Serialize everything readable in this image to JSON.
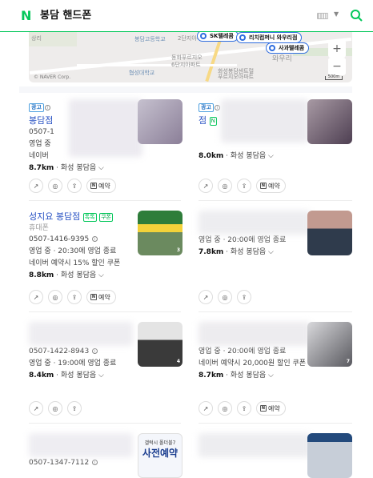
{
  "header": {
    "logo": "N",
    "query": "봉담 핸드폰"
  },
  "map": {
    "labels": {
      "a": "상리",
      "b": "봉담고등학교",
      "c": "2단지아파트",
      "d": "봉담대학교",
      "e": "동화푸르지오",
      "f": "6단지아파트",
      "g": "와우리",
      "h": "화성봉담센트럴",
      "i": "수영봉담풍림",
      "j": "아파트1단지",
      "k": "푸르지오아파트",
      "l": "협성대학교"
    },
    "pins": [
      "SK텔레콤",
      "리치컴퍼니 와우리점",
      "사과텔레콤"
    ],
    "attribution": "© NAVER Corp.",
    "scale": "500m",
    "zoom_in": "+",
    "zoom_out": "−"
  },
  "cards": [
    {
      "ad_label": "광고",
      "name": "봉담점",
      "phone": "0507-1",
      "status": "영업 중",
      "coupon": "네이버",
      "distance": "8.7km",
      "area": "화성 봉담읍",
      "has_reserve": true
    },
    {
      "ad_label": "광고",
      "name": "점",
      "phone": "",
      "status": "",
      "coupon": "",
      "distance": "8.0km",
      "area": "화성 봉담읍",
      "has_reserve": true
    },
    {
      "ad_label": "",
      "name": "성지요 봉담점",
      "category": "휴대폰",
      "phone": "0507-1416-9395",
      "status": "영업 중",
      "hours": "20:30에 영업 종료",
      "coupon": "네이버 예약시 15% 할인 쿠폰",
      "distance": "8.8km",
      "area": "화성 봉담읍",
      "has_reserve": true,
      "badge1": "톡톡",
      "badge2": "쿠폰"
    },
    {
      "ad_label": "",
      "name": "",
      "phone": "",
      "status": "영업 중",
      "hours": "20:00에 영업 종료",
      "distance": "7.8km",
      "area": "화성 봉담읍",
      "has_reserve": false
    },
    {
      "ad_label": "",
      "name": "",
      "phone": "0507-1422-8943",
      "status": "영업 중",
      "hours": "19:00에 영업 종료",
      "distance": "8.4km",
      "area": "화성 봉담읍",
      "has_reserve": false
    },
    {
      "ad_label": "",
      "name": "",
      "phone": "",
      "status": "영업 중",
      "hours": "20:00에 영업 종료",
      "coupon": "네이버 예약시 20,000원 할인 쿠폰",
      "distance": "8.7km",
      "area": "화성 봉담읍",
      "has_reserve": true
    },
    {
      "phone": "0507-1347-7112"
    }
  ],
  "reserve_label": "예약",
  "thumb_counts": {
    "c3": "3",
    "c5": "4",
    "c6": "7"
  },
  "promo_text": "사전예약",
  "promo_small": "갤럭시 폴더블7"
}
